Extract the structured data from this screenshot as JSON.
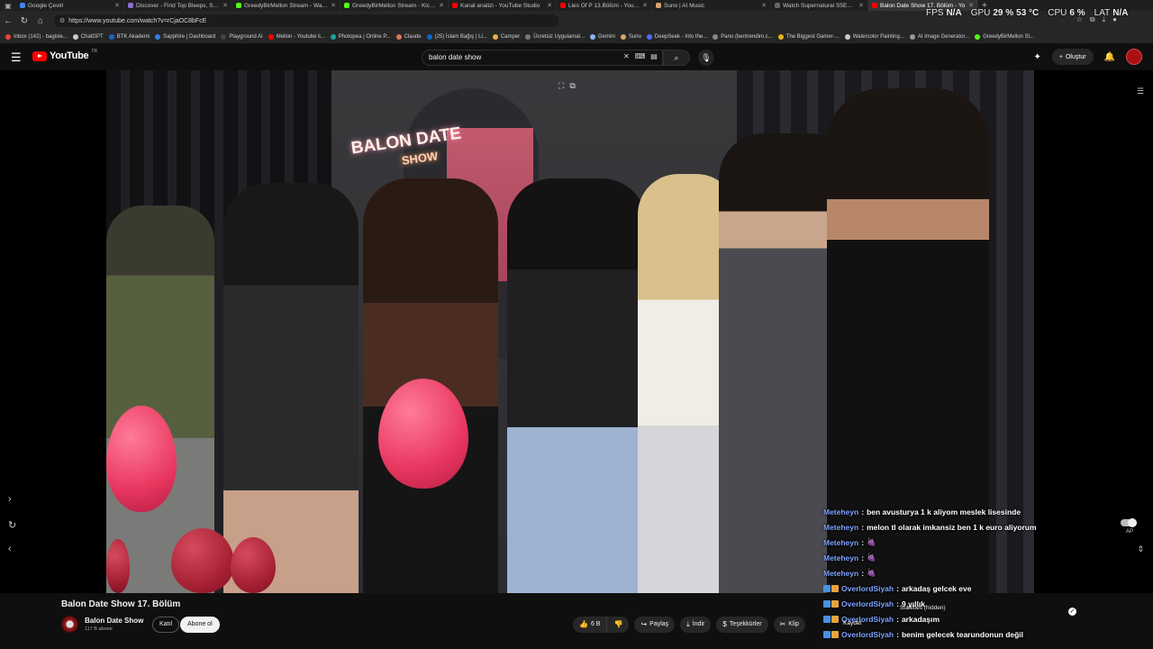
{
  "browser": {
    "tabs": [
      {
        "label": "Google Çeviri",
        "color": "#4285f4",
        "active": false
      },
      {
        "label": "Discover - Find Top Bleeps, Strea",
        "color": "#8a6fd1",
        "active": false
      },
      {
        "label": "GreedyBirMellon Stream - Watch",
        "color": "#53fc18",
        "active": false
      },
      {
        "label": "GreedyBirMellon Stream - Kick D",
        "color": "#53fc18",
        "active": false
      },
      {
        "label": "Kanal analizi - YouTube Studio",
        "color": "#ff0000",
        "active": false
      },
      {
        "label": "Lies Of P 13.Bölüm - YouTube",
        "color": "#ff0000",
        "active": false
      },
      {
        "label": "Suno | AI Music",
        "color": "#d9a36c",
        "active": false
      },
      {
        "label": "Watch Supernatural S5E13 onlin",
        "color": "#666666",
        "active": false
      },
      {
        "label": "Balon Date Show 17. Bölüm - Yo",
        "color": "#ff0000",
        "active": true
      }
    ],
    "url": "https://www.youtube.com/watch?v=rCjaOC8bFcE",
    "bookmarks": [
      {
        "label": "Inbox (142) - bagisle...",
        "color": "#ea4335"
      },
      {
        "label": "ChatGPT",
        "color": "#cccccc"
      },
      {
        "label": "BTK Akademi",
        "color": "#1e63c9"
      },
      {
        "label": "Sapphire | Dashboard",
        "color": "#2f80ed"
      },
      {
        "label": "Playground AI",
        "color": "#444444"
      },
      {
        "label": "Mellon - Youtube li...",
        "color": "#ff0000"
      },
      {
        "label": "Photopea | Online P...",
        "color": "#18a497"
      },
      {
        "label": "Claude",
        "color": "#d97757"
      },
      {
        "label": "(25) İslam Bağış | Li...",
        "color": "#0a66c2"
      },
      {
        "label": "Camper",
        "color": "#e3b341"
      },
      {
        "label": "Ücretsiz Uygulamal...",
        "color": "#777777"
      },
      {
        "label": "Gemini",
        "color": "#8ab4f8"
      },
      {
        "label": "Suno",
        "color": "#d9a36c"
      },
      {
        "label": "DeepSeek - Into the...",
        "color": "#4d6bfe"
      },
      {
        "label": "Pano (bentrendim.c...",
        "color": "#888888"
      },
      {
        "label": "The Biggest Gamer-...",
        "color": "#e7b416"
      },
      {
        "label": "Watercolor Painting...",
        "color": "#cccccc"
      },
      {
        "label": "AI Image Generator...",
        "color": "#999999"
      },
      {
        "label": "GreedyBirMellon St...",
        "color": "#53fc18"
      }
    ]
  },
  "perf": {
    "fps_label": "FPS",
    "fps_value": "N/A",
    "gpu_label": "GPU",
    "gpu_value": "29 %",
    "gpu_temp": "53 °C",
    "cpu_label": "CPU",
    "cpu_value": "6 %",
    "lat_label": "LAT",
    "lat_value": "N/A"
  },
  "youtube": {
    "logo_text": "YouTube",
    "logo_country": "TR",
    "search_value": "balon date show",
    "create_label": "Oluştur"
  },
  "video": {
    "neon_line1": "BALON DATE",
    "neon_line2": "SHOW",
    "ap_label": "AP",
    "subtitle_popup": "Subtitles (hidden)",
    "save_label": "Kaydet"
  },
  "chat": [
    {
      "user": "Meteheyn",
      "text": "ben avusturya 1 k aliyom meslek lisesinde",
      "badges": []
    },
    {
      "user": "Meteheyn",
      "text": "melon tl olarak imkansiz ben 1 k euro aliyorum",
      "badges": []
    },
    {
      "user": "Meteheyn",
      "text": "🍇",
      "badges": []
    },
    {
      "user": "Meteheyn",
      "text": "🍇",
      "badges": []
    },
    {
      "user": "Meteheyn",
      "text": "🍇",
      "badges": []
    },
    {
      "user": "OverlordSiyah",
      "text": "arkadaş gelcek eve",
      "badges": [
        "#4a90e2",
        "#e8a33d"
      ]
    },
    {
      "user": "OverlordSiyah",
      "text": "9 yıllık",
      "badges": [
        "#4a90e2",
        "#e8a33d"
      ]
    },
    {
      "user": "OverlordSiyah",
      "text": "arkadaşım",
      "badges": [
        "#4a90e2",
        "#e8a33d"
      ]
    },
    {
      "user": "OverlordSiyah",
      "text": "benim gelecek tearundonun değil",
      "badges": [
        "#4a90e2",
        "#e8a33d"
      ]
    }
  ],
  "meta": {
    "title": "Balon Date Show 17. Bölüm",
    "channel": "Balon Date Show",
    "subscribers": "117 B abone",
    "join_label": "Katıl",
    "subscribe_label": "Abone ol",
    "like_count": "6 B",
    "share_label": "Paylaş",
    "download_label": "İndir",
    "thanks_label": "Teşekkürler",
    "clip_label": "Klip"
  }
}
